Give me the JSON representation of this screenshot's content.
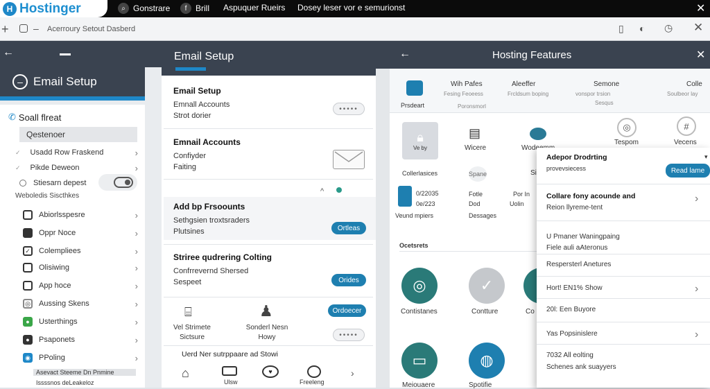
{
  "topbar": {
    "brand": "Hostinger",
    "items": [
      "Gonstrare",
      "Brill",
      "Aspuquer Rueirs"
    ],
    "extra": "Dosey leser vor e semurionst",
    "close": "✕"
  },
  "addressbar": {
    "breadcrumb": "Acerroury Setout Dasberd"
  },
  "left_panel": {
    "title": "Email Setup",
    "section": "Soall flreat",
    "field": "Qestenoer",
    "items": [
      "Usadd Row Fraskend",
      "Pikde Deweon",
      "Stiesarn depest"
    ],
    "websites": "Weboledis Siscthkes",
    "list": [
      "Abiorlsspesre",
      "Oppr Noce",
      "Colempliees",
      "Olisiwing",
      "App hoce",
      "Aussing Skens",
      "Usterthings",
      "Psaponets",
      "PPoling"
    ],
    "footer1": "Asevact Steeme Dn Pnmine",
    "footer2": "Issssnos deLeakeloz"
  },
  "center_panel": {
    "title": "Email Setup",
    "s1_title": "Email Setup",
    "s1_line1": "Emnall Accounts",
    "s1_line2": "Strot dorier",
    "s2_title": "Emnail Accounts",
    "s2_line1": "Confiyder",
    "s2_line2": "Faiting",
    "s3_title": "Add bp Frsoounts",
    "s3_line1": "Sethgsien troxtsraders",
    "s3_line2": "Plutsines",
    "s3_button": "Ortleas",
    "s4_title": "Striree qudrering Colting",
    "s4_line1": "Confrrevernd Shersed",
    "s4_line2": "Sespeet",
    "s4_button": "Orides",
    "s5_button": "Ordoecer",
    "s5_item1_l1": "Vel Strimete",
    "s5_item1_l2": "Sictsure",
    "s5_item2_l1": "Sonderl Nesn",
    "s5_item2_l2": "Howy",
    "footer_title": "Uerd Ner sutrppaare ad Stowi",
    "bottom_labels": [
      "Ulsw",
      "Freeleng"
    ]
  },
  "right_panel": {
    "title": "Hosting Features",
    "top_cols": [
      {
        "title": "Wih Pafes",
        "line1": "Fesing Feoeess",
        "line2": "Poronsmorl"
      },
      {
        "title": "Aleeffer",
        "line1": "Frcldsum boping",
        "line2": ""
      },
      {
        "title": "Semone",
        "line1": "vonspor trsion",
        "line2": "Sesqus"
      },
      {
        "title": "Colle",
        "line1": "Soulbeor lay",
        "line2": ""
      }
    ],
    "left_label": "Prsdeart",
    "icons_row": [
      "Ve by",
      "Wicere",
      "Wodeemm",
      "Tespom",
      "Vecens"
    ],
    "ca_label": "Collerlasices",
    "spane": "Spane",
    "si": "Si",
    "stat1": "0/22035",
    "stat2": "0e/223",
    "stat3": "Fotle",
    "stat4": "Dod",
    "stat5": "Por In",
    "stat6": "Uolin",
    "stat7": "Veund mpiers",
    "stat8": "Dessages",
    "section": "Ocetsrets",
    "circles": [
      "Contistanes",
      "Contture",
      "Co"
    ],
    "bottom": [
      "Meiouaere",
      "Spotifie"
    ]
  },
  "popup": {
    "title": "Adepor Drodrting",
    "subtitle": "provevsiecess",
    "button": "Read lame",
    "r1_title": "Collare fony acounde and",
    "r1_sub": "Reion llyreme-tent",
    "r2_title": "U Pmaner Waningpaing",
    "r2_sub": "Fiele auli aAteronus",
    "r3": "Respersterl Anetures",
    "r4": "Hort! EN1% Show",
    "r5": "20l: Een Buyore",
    "r6": "Yas Popsinislere",
    "r7_title": "7032 All eolting",
    "r7_sub": "Schenes ank suayyers"
  },
  "colors": {
    "accent": "#1e88c8",
    "dark": "#3a4350",
    "teal": "#2a7a78",
    "button_blue": "#1e7fb0"
  }
}
